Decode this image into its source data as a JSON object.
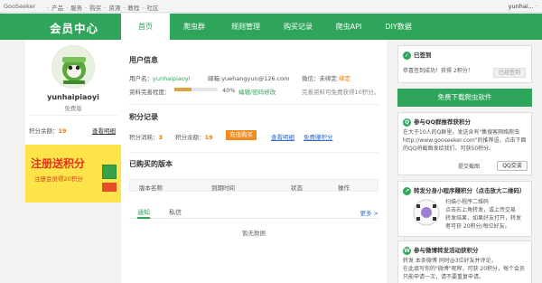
{
  "topbar": {
    "brand": "GooSeeker",
    "menu": [
      "·",
      "产品",
      "·",
      "服务",
      "·",
      "购买",
      "·",
      "资源",
      "·",
      "教程",
      "·",
      "社区"
    ],
    "user": "yunhai... ·"
  },
  "nav": {
    "title": "会员中心",
    "tabs": [
      "首页",
      "爬虫群",
      "规则管理",
      "购买记录",
      "爬虫API",
      "DIY数据"
    ],
    "active": 0
  },
  "profile": {
    "username": "yunhaipiaoyi",
    "level": "免费版",
    "points_label": "积分余额：",
    "points_value": "19",
    "details_link": "查看明细",
    "banner_title": "注册送积分",
    "banner_sub": "注册会员得20积分"
  },
  "user_info": {
    "title": "用户信息",
    "username_label": "用户名：",
    "username": "yunhaipiaoyi",
    "email": "邮箱:yuehangyun@126.com",
    "wechat_label": "微信：未绑定",
    "wechat_bind": "绑定",
    "completeness_label": "资料完善程度：",
    "completeness_pct": "40%",
    "completeness_value": 0.4,
    "edit_link": "编辑/密码修改",
    "hint": "完善资料可免费获得10积分。"
  },
  "points": {
    "title": "积分记录",
    "used_label": "积分消耗：",
    "used_value": "3",
    "balance_label": "积分余额：",
    "balance_value": "19",
    "recharge": "充值购买",
    "details_link": "查看明细",
    "free_link": "免费赚积分"
  },
  "versions": {
    "title": "已购买的版本",
    "columns": [
      "版本名称",
      "到期时间",
      "状态",
      "操作"
    ]
  },
  "notices": {
    "tabs": [
      "通知",
      "私信"
    ],
    "more": "更多 >",
    "empty": "暂无数据"
  },
  "sidebar": {
    "signin": {
      "title": "已签到",
      "text": "恭喜签到成功！获得 2积分！",
      "button": "已经签到"
    },
    "download_button": "免费下载爬虫软件",
    "qq": {
      "title": "参与QQ群推荐获积分",
      "text": [
        "在大于10人的Q群里，发送含有\"集搜客网络爬虫http://www.gooseeker.com\"的推荐语，点击下面的QQ将截图发给我们，可获50积分。"
      ],
      "submit_label": "提交截图",
      "qq_button": "QQ交谈"
    },
    "miniprogram": {
      "title": "转发分身小程序赚积分（点击放大二维码）",
      "lines": [
        "扫描小程序二维码",
        "点击右上角转发，或上传交易",
        "转发结果，如果好友打开，转发",
        "者可获 20积分/每位好友。"
      ]
    },
    "weibo": {
      "title": "参与微博转发活动获积分",
      "lines": [
        "转发 本条微博 同时@3位好友并评论，",
        "在此填写你的\"微博\"昵称，可获 20积分，每个会员只能申请一次，请不要重复申请。"
      ]
    }
  }
}
